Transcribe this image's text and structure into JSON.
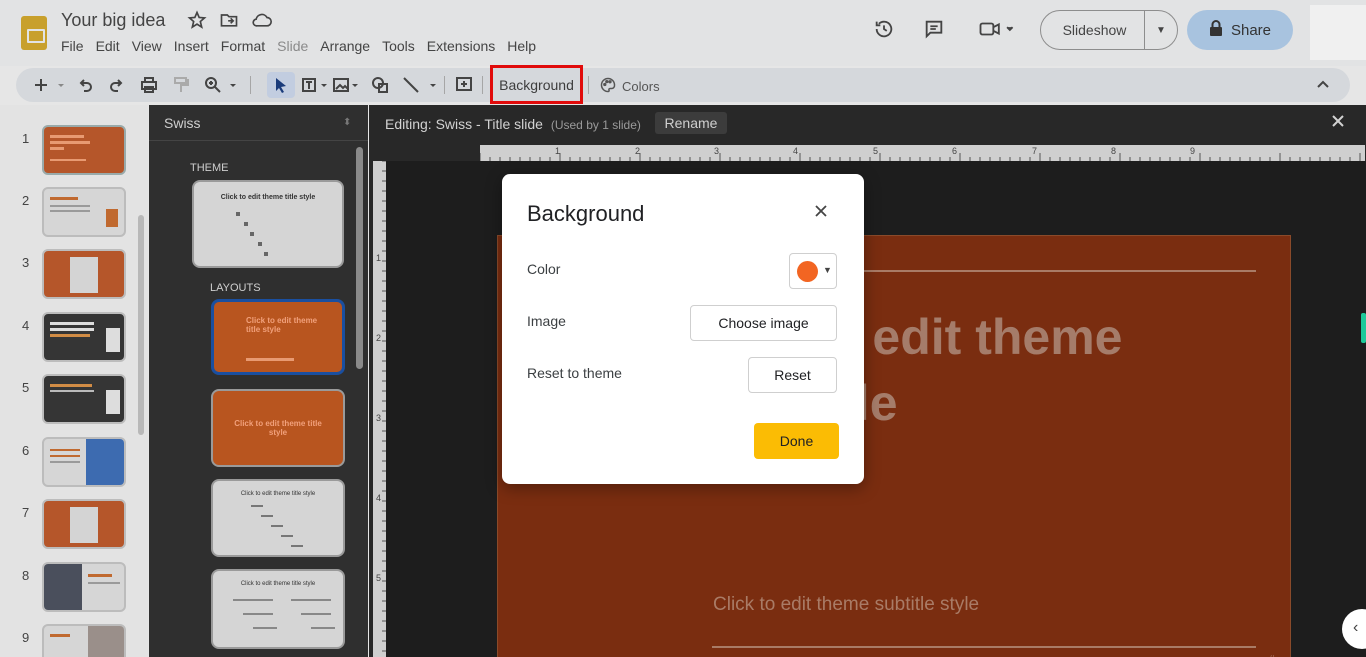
{
  "app": {
    "doc_title": "Your big idea",
    "menu": [
      "File",
      "Edit",
      "View",
      "Insert",
      "Format",
      "Slide",
      "Arrange",
      "Tools",
      "Extensions",
      "Help"
    ],
    "slideshow_label": "Slideshow",
    "share_label": "Share"
  },
  "toolbar": {
    "background_label": "Background",
    "colors_label": "Colors"
  },
  "filmstrip": {
    "numbers": [
      "1",
      "2",
      "3",
      "4",
      "5",
      "6",
      "7",
      "8",
      "9"
    ]
  },
  "theme_panel": {
    "title": "Swiss",
    "theme_label": "THEME",
    "layouts_label": "LAYOUTS",
    "theme_thumb_text": "Click to edit theme title style",
    "layout_1_text": "Click to edit theme title style",
    "layout_2_text": "Click to edit theme title style",
    "layout_3_text": "Click to edit theme title style",
    "layout_4_text": "Click to edit theme title style"
  },
  "editor": {
    "editing_label": "Editing: Swiss - Title slide",
    "used_by": "(Used by 1 slide)",
    "rename_label": "Rename",
    "ruler_top": [
      "1",
      "2",
      "3",
      "4",
      "5",
      "6",
      "7",
      "8",
      "9"
    ],
    "ruler_left": [
      "1",
      "2",
      "3",
      "4",
      "5"
    ],
    "slide_title_line1": "o edit theme",
    "slide_title_line2": "yle",
    "slide_subtitle": "Click to edit theme subtitle style",
    "slide_number": "#"
  },
  "dialog": {
    "title": "Background",
    "color_label": "Color",
    "image_label": "Image",
    "choose_image_label": "Choose image",
    "reset_theme_label": "Reset to theme",
    "reset_label": "Reset",
    "done_label": "Done",
    "selected_color": "#f26522"
  },
  "colors": {
    "accent_highlight": "#e10b0b",
    "done_button": "#fbbc04",
    "slide_background": "#7a2d10"
  }
}
